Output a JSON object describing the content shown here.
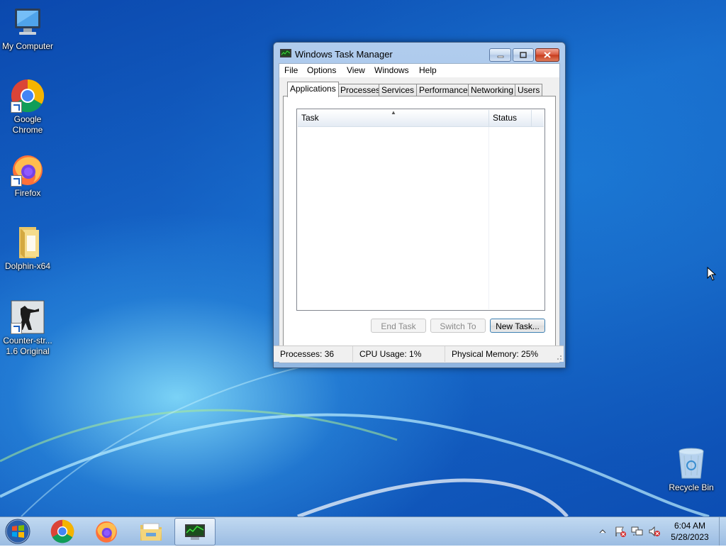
{
  "desktop": {
    "icons": [
      {
        "label": "My Computer",
        "icon": "computer-icon"
      },
      {
        "label": "Google Chrome",
        "icon": "chrome-icon"
      },
      {
        "label": "Firefox",
        "icon": "firefox-icon"
      },
      {
        "label": "Dolphin-x64",
        "icon": "folder-icon"
      },
      {
        "label": "Counter-str... 1.6 Original",
        "icon": "counter-strike-icon"
      },
      {
        "label": "Recycle Bin",
        "icon": "recycle-bin-icon"
      }
    ]
  },
  "window": {
    "title": "Windows Task Manager",
    "menu": [
      "File",
      "Options",
      "View",
      "Windows",
      "Help"
    ],
    "tabs": [
      "Applications",
      "Processes",
      "Services",
      "Performance",
      "Networking",
      "Users"
    ],
    "active_tab": "Applications",
    "list": {
      "columns": [
        "Task",
        "Status"
      ],
      "rows": []
    },
    "buttons": {
      "end_task": "End Task",
      "switch_to": "Switch To",
      "new_task": "New Task..."
    },
    "status": {
      "processes": "Processes: 36",
      "cpu": "CPU Usage: 1%",
      "memory": "Physical Memory: 25%"
    }
  },
  "taskbar": {
    "pinned": [
      "chrome-icon",
      "firefox-icon",
      "explorer-icon",
      "task-manager-icon"
    ],
    "tray_icons": [
      "show-hidden-icons-arrow",
      "action-center-flag-icon",
      "network-icon",
      "volume-muted-icon"
    ],
    "clock": {
      "time": "6:04 AM",
      "date": "5/28/2023"
    }
  },
  "colors": {
    "wallpaper": "#1a73cf",
    "title_close": "#c63a1c",
    "taskbar": "#a9c6e6"
  }
}
